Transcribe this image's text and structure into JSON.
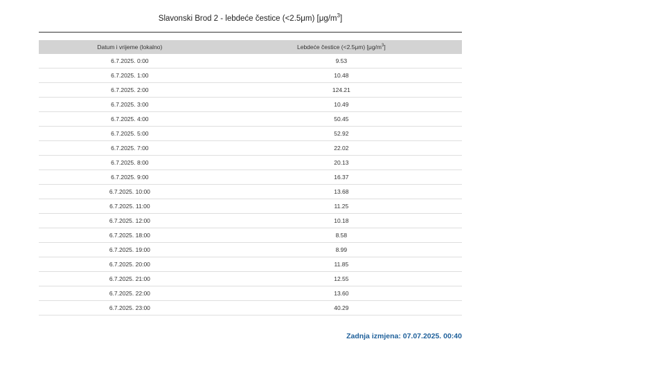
{
  "title": {
    "text": "Slavonski Brod 2 - lebdeće čestice (<2.5μm) [μg/m",
    "sup": "3",
    "suffix": "]"
  },
  "table": {
    "headers": {
      "time": "Datum i vrijeme (lokalno)",
      "value": "Lebdeće čestice (<2.5μm) [μg/m",
      "value_sup": "3",
      "value_suffix": "]"
    },
    "rows": [
      {
        "time": "6.7.2025. 0:00",
        "value": "9.53"
      },
      {
        "time": "6.7.2025. 1:00",
        "value": "10.48"
      },
      {
        "time": "6.7.2025. 2:00",
        "value": "124.21"
      },
      {
        "time": "6.7.2025. 3:00",
        "value": "10.49"
      },
      {
        "time": "6.7.2025. 4:00",
        "value": "50.45"
      },
      {
        "time": "6.7.2025. 5:00",
        "value": "52.92"
      },
      {
        "time": "6.7.2025. 7:00",
        "value": "22.02"
      },
      {
        "time": "6.7.2025. 8:00",
        "value": "20.13"
      },
      {
        "time": "6.7.2025. 9:00",
        "value": "16.37"
      },
      {
        "time": "6.7.2025. 10:00",
        "value": "13.68"
      },
      {
        "time": "6.7.2025. 11:00",
        "value": "11.25"
      },
      {
        "time": "6.7.2025. 12:00",
        "value": "10.18"
      },
      {
        "time": "6.7.2025. 18:00",
        "value": "8.58"
      },
      {
        "time": "6.7.2025. 19:00",
        "value": "8.99"
      },
      {
        "time": "6.7.2025. 20:00",
        "value": "11.85"
      },
      {
        "time": "6.7.2025. 21:00",
        "value": "12.55"
      },
      {
        "time": "6.7.2025. 22:00",
        "value": "13.60"
      },
      {
        "time": "6.7.2025. 23:00",
        "value": "40.29"
      }
    ]
  },
  "footer": {
    "last_change": "Zadnja izmjena: 07.07.2025. 00:40"
  },
  "colors": {
    "header_bg": "#d3d3d3",
    "footer_text": "#1d5f9a",
    "row_divider": "#dedede"
  }
}
